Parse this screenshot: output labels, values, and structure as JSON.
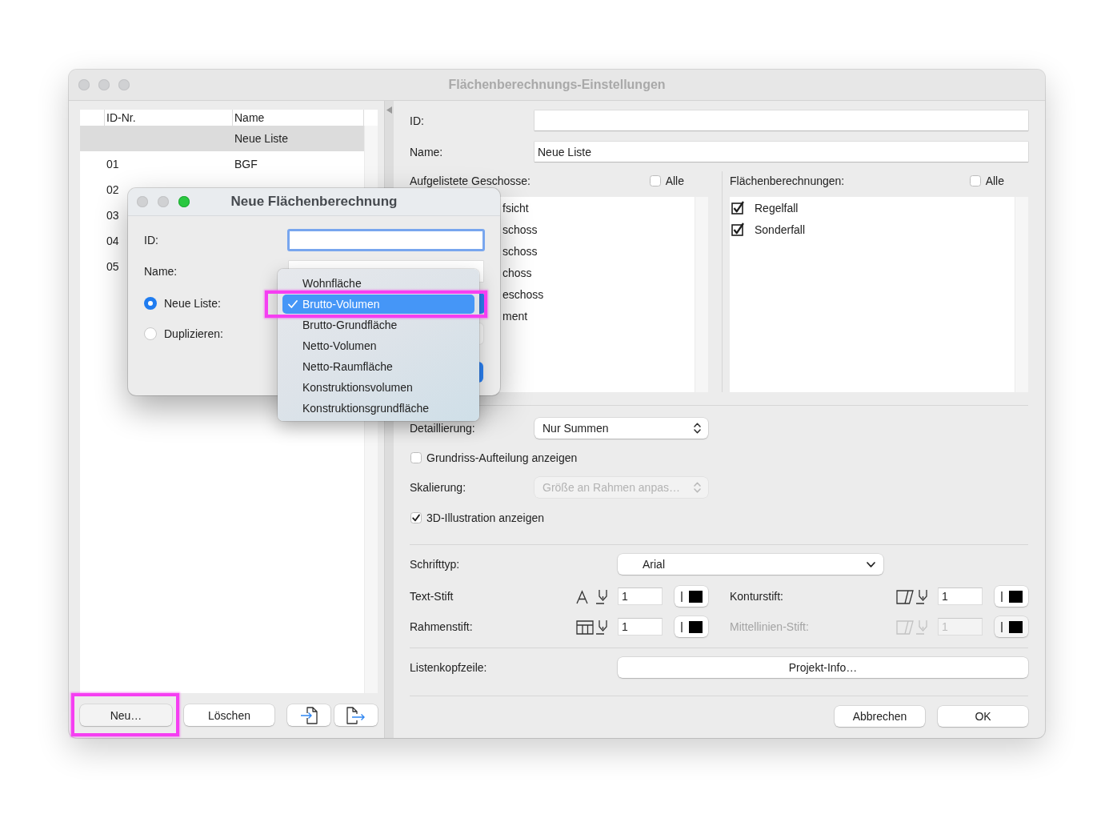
{
  "window": {
    "title": "Flächenberechnungs-Einstellungen"
  },
  "list_table": {
    "columns": [
      "ID-Nr.",
      "Name"
    ],
    "rows": [
      {
        "name": "Neue Liste",
        "selected": true
      },
      {
        "id": "01",
        "name": "BGF",
        "selected": false
      },
      {
        "id": "02",
        "selected": false
      },
      {
        "id": "03",
        "selected": false
      },
      {
        "id": "04",
        "selected": false
      },
      {
        "id": "05",
        "selected": false
      }
    ]
  },
  "list_buttons": [
    {
      "kind": "new",
      "label": "Neu…",
      "highlighted": true
    },
    {
      "kind": "delete",
      "label": "Löschen",
      "highlighted": false
    },
    {
      "kind": "import",
      "highlighted": false
    },
    {
      "kind": "export",
      "highlighted": false
    }
  ],
  "settings": {
    "id": {
      "label": "ID:"
    },
    "name": {
      "label": "Name:",
      "value": "Neue Liste"
    },
    "stories": {
      "label": "Aufgelistete Geschosse:",
      "all": {
        "label": "Alle",
        "checked": false
      },
      "items": [
        "fsicht",
        "schoss",
        "schoss",
        "choss",
        "eschoss",
        "ment"
      ]
    },
    "area_calculations": {
      "label": "Flächenberechnungen:",
      "all": {
        "label": "Alle",
        "checked": false
      },
      "items": [
        {
          "label": "Regelfall",
          "checked": true
        },
        {
          "label": "Sonderfall",
          "checked": true
        }
      ]
    },
    "detail": {
      "label": "Detaillierung:",
      "value": "Nur Summen"
    },
    "show_plan_split": {
      "label": "Grundriss-Aufteilung anzeigen",
      "checked": false
    },
    "scaling": {
      "label": "Skalierung:",
      "value": "Größe an Rahmen anpas…",
      "disabled": true
    },
    "show_3d": {
      "label": "3D-Illustration anzeigen",
      "checked": true
    },
    "font": {
      "label": "Schrifttyp:",
      "value": "Arial"
    },
    "pens": [
      {
        "kind": "text",
        "label": "Text-Stift",
        "value": "1",
        "disabled": false
      },
      {
        "kind": "contour",
        "label": "Konturstift:",
        "value": "1",
        "disabled": false
      },
      {
        "kind": "frame",
        "label": "Rahmenstift:",
        "value": "1",
        "disabled": false
      },
      {
        "kind": "centerline",
        "label": "Mittellinien-Stift:",
        "value": "1",
        "disabled": true
      }
    ],
    "list_header": {
      "label": "Listenkopfzeile:",
      "button": "Projekt-Info…"
    },
    "buttons": [
      "Abbrechen",
      "OK"
    ]
  },
  "dialog": {
    "title": "Neue Flächenberechnung",
    "id": {
      "label": "ID:",
      "focused": true
    },
    "name": {
      "label": "Name:"
    },
    "sources": [
      {
        "label": "Neue Liste:",
        "selected": true
      },
      {
        "label": "Duplizieren:",
        "selected": false
      }
    ],
    "menu": [
      {
        "label": "Wohnfläche",
        "selected": false,
        "highlighted": false
      },
      {
        "label": "Brutto-Volumen",
        "selected": true,
        "highlighted": true
      },
      {
        "label": "Brutto-Grundfläche",
        "selected": false,
        "highlighted": false
      },
      {
        "label": "Netto-Volumen",
        "selected": false,
        "highlighted": false
      },
      {
        "label": "Netto-Raumfläche",
        "selected": false,
        "highlighted": false
      },
      {
        "label": "Konstruktionsvolumen",
        "selected": false,
        "highlighted": false
      },
      {
        "label": "Konstruktionsgrundfläche",
        "selected": false,
        "highlighted": false
      }
    ]
  }
}
